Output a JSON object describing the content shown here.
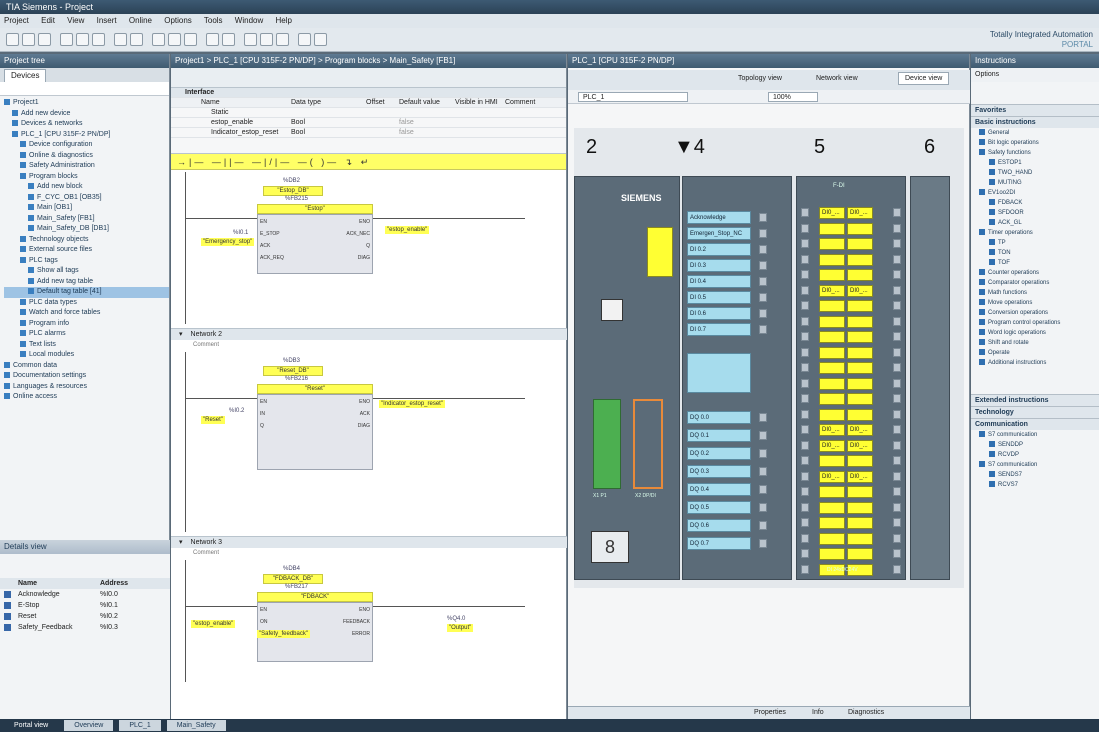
{
  "window": {
    "title": "TIA Siemens - Project"
  },
  "menu": [
    "Project",
    "Edit",
    "View",
    "Insert",
    "Online",
    "Options",
    "Tools",
    "Window",
    "Help"
  ],
  "brand": {
    "line1": "Totally Integrated Automation",
    "line2": "PORTAL"
  },
  "project_tree": {
    "header": "Project tree",
    "tab": "Devices",
    "items": [
      "Project1",
      "Add new device",
      "Devices & networks",
      "PLC_1 [CPU 315F-2 PN/DP]",
      "Device configuration",
      "Online & diagnostics",
      "Safety Administration",
      "Program blocks",
      "Add new block",
      "F_CYC_OB1 [OB35]",
      "Main [OB1]",
      "Main_Safety [FB1]",
      "Main_Safety_DB [DB1]",
      "Technology objects",
      "External source files",
      "PLC tags",
      "Show all tags",
      "Add new tag table",
      "Default tag table [41]",
      "PLC data types",
      "Watch and force tables",
      "Program info",
      "PLC alarms",
      "Text lists",
      "Local modules",
      "Common data",
      "Documentation settings",
      "Languages & resources",
      "Online access"
    ],
    "selected_index": 18
  },
  "details_view": {
    "header": "Details view",
    "columns": [
      "Name",
      "Address"
    ],
    "rows": [
      {
        "name": "Acknowledge",
        "addr": "%I0.0"
      },
      {
        "name": "E-Stop",
        "addr": "%I0.1"
      },
      {
        "name": "Reset",
        "addr": "%I0.2"
      },
      {
        "name": "Safety_Feedback",
        "addr": "%I0.3"
      }
    ]
  },
  "editor": {
    "breadcrumb": "Project1 > PLC_1 [CPU 315F-2 PN/DP] > Program blocks > Main_Safety [FB1]",
    "interface_label": "Interface",
    "interface_columns": [
      "Name",
      "Data type",
      "Offset",
      "Default value",
      "Visible in HMI",
      "Comment"
    ],
    "interface_rows": [
      {
        "name": "Static",
        "type": "",
        "value": ""
      },
      {
        "name": "estop_enable",
        "type": "Bool",
        "value": "false"
      },
      {
        "name": "Indicator_estop_reset",
        "type": "Bool",
        "value": "false"
      }
    ],
    "ladder_tools": "→|— —||— —|/|— —( )— ↴ ↵",
    "networks": [
      {
        "title": "Network 1",
        "comment": "Comment",
        "instance": "%DB2",
        "instance_name": "\"Estop_DB\"",
        "fb": "%FB215",
        "fb_name": "\"Estop\"",
        "pins": [
          "EN",
          "ENO",
          "E_STOP",
          "ACK_NEC",
          "ACK",
          "Q",
          "ACK_REQ",
          "DIAG"
        ],
        "tags": [
          "%I0.1",
          "\"Emergency_stop\"",
          "\"estop_enable\""
        ]
      },
      {
        "title": "Network 2",
        "comment": "Comment",
        "instance": "%DB3",
        "instance_name": "\"Reset_DB\"",
        "fb": "%FB216",
        "fb_name": "\"Reset\"",
        "pins": [
          "EN",
          "ENO",
          "IN",
          "ACK",
          "Q",
          "DIAG"
        ],
        "tags": [
          "%I0.2",
          "\"Reset\"",
          "\"Indicator_estop_reset\""
        ]
      },
      {
        "title": "Network 3",
        "comment": "Comment",
        "instance": "%DB4",
        "instance_name": "\"FDBACK_DB\"",
        "fb": "%FB217",
        "fb_name": "\"FDBACK\"",
        "pins": [
          "EN",
          "ENO",
          "ON",
          "FEEDBACK",
          "Q",
          "ERROR"
        ],
        "tags": [
          "\"estop_enable\"",
          "\"Safety_feedback\"",
          "%Q4.0",
          "\"Output\""
        ]
      }
    ]
  },
  "device_view": {
    "header": "PLC_1 [CPU 315F-2 PN/DP]",
    "tabs": [
      "Topology view",
      "Network view",
      "Device view"
    ],
    "device_select": "PLC_1",
    "zoom": "100%",
    "slots": [
      "2",
      "▼4",
      "5",
      "6"
    ],
    "cpu": {
      "brand": "SIEMENS",
      "port1": "X1 P1",
      "port2": "X2 DP/DI"
    },
    "di_channels": [
      "Acknowledge",
      "Emergen_Stop_NC",
      "DI 0.2",
      "DI 0.3",
      "DI 0.4",
      "DI 0.5",
      "DI 0.6",
      "DI 0.7"
    ],
    "do_channels": [
      "DQ 0.0",
      "DQ 0.1",
      "DQ 0.2",
      "DQ 0.3",
      "DQ 0.4",
      "DQ 0.5",
      "DQ 0.6",
      "DQ 0.7"
    ],
    "f_di_header": "F-DI",
    "f_channel_a": "DI0_...",
    "f_channel_b": "DI0_...",
    "f_footer": "DI 24xDC24V"
  },
  "instructions": {
    "header": "Instructions",
    "options_label": "Options",
    "favorites": "Favorites",
    "sections": [
      "Basic instructions",
      "Extended instructions",
      "Technology",
      "Communication"
    ],
    "basic_items": [
      "General",
      "Bit logic operations",
      "Safety functions",
      "ESTOP1",
      "TWO_HAND",
      "MUTING",
      "EV1oo2DI",
      "FDBACK",
      "SFDOOR",
      "ACK_GL",
      "Timer operations",
      "TP",
      "TON",
      "TOF",
      "Counter operations",
      "Comparator operations",
      "Math functions",
      "Move operations",
      "Conversion operations",
      "Program control operations",
      "Word logic operations",
      "Shift and rotate",
      "Operate",
      "Additional instructions"
    ],
    "comm_items": [
      "S7 communication",
      "SENDDP",
      "RCVDP",
      "S7 communication",
      "SENDS7",
      "RCVS7"
    ]
  },
  "inspector": {
    "properties": "Properties",
    "info": "Info",
    "diagnostics": "Diagnostics"
  },
  "taskbar": [
    "Portal view",
    "Overview",
    "PLC_1",
    "Main_Safety"
  ]
}
